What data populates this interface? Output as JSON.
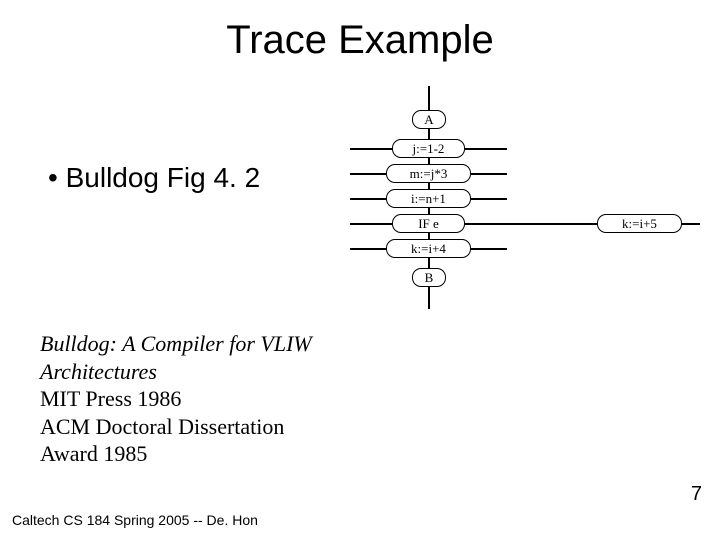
{
  "title": "Trace Example",
  "bullet": "Bulldog Fig 4. 2",
  "reference": {
    "book_title": "Bulldog: A Compiler for VLIW Architectures",
    "line1": "MIT Press 1986",
    "line2": "ACM Doctoral Dissertation Award 1985"
  },
  "footer": "Caltech CS 184 Spring 2005 -- De. Hon",
  "page_number": "7",
  "diagram": {
    "nodes": {
      "A": "A",
      "j": "j:=1-2",
      "m": "m:=j*3",
      "i": "i:=n+1",
      "if": "IF e",
      "k4": "k:=i+4",
      "B": "B",
      "k5": "k:=i+5"
    }
  }
}
